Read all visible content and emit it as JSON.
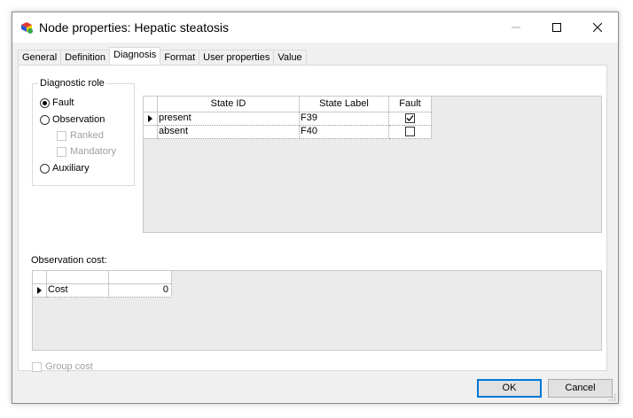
{
  "window": {
    "title": "Node properties: Hepatic steatosis",
    "icon": "app-network-icon"
  },
  "tabs": [
    "General",
    "Definition",
    "Diagnosis",
    "Format",
    "User properties",
    "Value"
  ],
  "active_tab": "Diagnosis",
  "diagnostic_role": {
    "label": "Diagnostic role",
    "options": {
      "fault": "Fault",
      "observation": "Observation",
      "ranked": "Ranked",
      "mandatory": "Mandatory",
      "auxiliary": "Auxiliary"
    },
    "selected": "Fault"
  },
  "states_grid": {
    "headers": [
      "State ID",
      "State Label",
      "Fault"
    ],
    "rows": [
      {
        "id": "present",
        "label": "F39",
        "fault": true
      },
      {
        "id": "absent",
        "label": "F40",
        "fault": false
      }
    ]
  },
  "observation_cost": {
    "label": "Observation cost:",
    "headers": [
      "",
      ""
    ],
    "rows": [
      {
        "name": "Cost",
        "value": "0"
      }
    ]
  },
  "group_cost": {
    "label": "Group cost",
    "checked": false
  },
  "buttons": {
    "ok": "OK",
    "cancel": "Cancel"
  }
}
